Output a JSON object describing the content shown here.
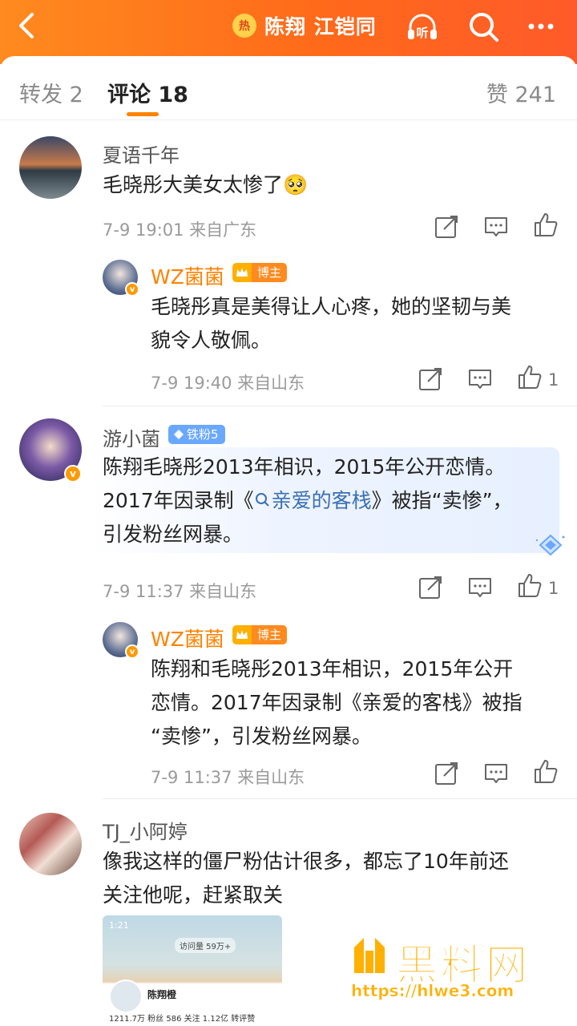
{
  "header": {
    "hot_badge": "热",
    "title": "陈翔 江铠同",
    "icons": [
      "back-icon",
      "listen-icon",
      "search-icon",
      "more-icon"
    ],
    "listen_label": "听"
  },
  "tabs": {
    "repost": "转发 2",
    "comment": "评论 18",
    "like": "赞 241"
  },
  "comments": [
    {
      "user": "夏语千年",
      "text": "毛晓彤大美女太惨了🥺",
      "meta": "7-9 19:01 来自广东",
      "reply": {
        "user": "WZ菌菌",
        "badge": "博主",
        "text_line1": "毛晓彤真是美得让人心疼，她的坚韧与美",
        "text_line2": "貌令人敬佩。",
        "meta": "7-9 19:40 来自山东",
        "likes": "1"
      }
    },
    {
      "user": "游小菌",
      "badge": "铁粉5",
      "text_line1": "陈翔毛晓彤2013年相识，2015年公开恋情。",
      "text_line2_a": "2017年因录制《",
      "text_line2_link": "亲爱的客栈",
      "text_line2_b": "》被指“卖惨”，",
      "text_line3": "引发粉丝网暴。",
      "meta": "7-9 11:37 来自山东",
      "likes": "1",
      "reply": {
        "user": "WZ菌菌",
        "badge": "博主",
        "text_line1": "陈翔和毛晓彤2013年相识，2015年公开",
        "text_line2": "恋情。2017年因录制《亲爱的客栈》被指",
        "text_line3": "“卖惨”，引发粉丝网暴。",
        "meta": "7-9 11:37 来自山东"
      }
    },
    {
      "user": "TJ_小阿婷",
      "text_line1": "像我这样的僵尸粉估计很多，都忘了10年前还",
      "text_line2": "关注他呢，赶紧取关",
      "screenshot": {
        "time": "1:21",
        "visits": "访问量 59万+",
        "name": "陈翔橙",
        "stats": "1211.7万 粉丝   586 关注   1.12亿 转评赞"
      }
    }
  ],
  "watermark": {
    "text": "黑料网",
    "url": "https://hlwe3.com"
  },
  "colors": {
    "brand_orange": "#ff8200",
    "link_blue": "#3a6fb5",
    "fan_badge": "#6aa8ff"
  }
}
